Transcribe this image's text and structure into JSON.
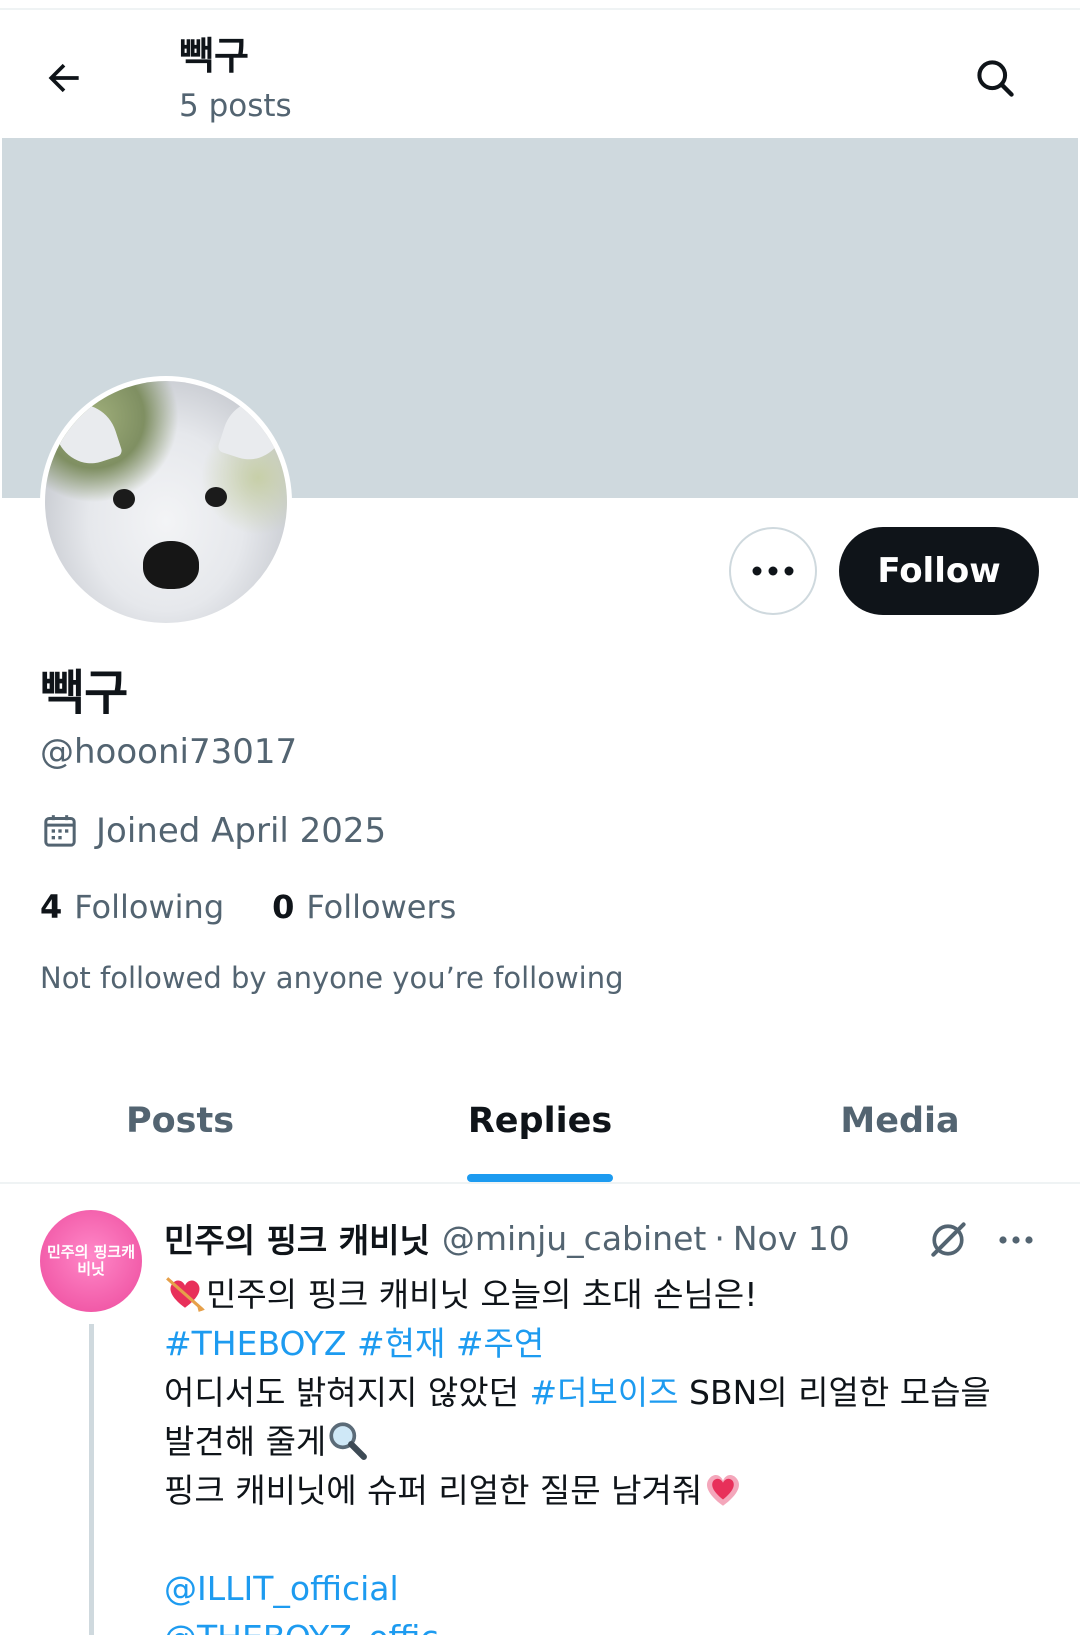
{
  "header": {
    "title": "빽구",
    "posts_count": "5 posts",
    "icons": {
      "back": "arrow-left-icon",
      "search": "search-icon"
    }
  },
  "profile": {
    "display_name": "빽구",
    "handle": "@hoooni73017",
    "joined": "Joined April 2025",
    "following_count": "4",
    "following_label": "Following",
    "followers_count": "0",
    "followers_label": "Followers",
    "not_followed_text": "Not followed by anyone you’re following",
    "follow_label": "Follow"
  },
  "tabs": [
    {
      "label": "Posts",
      "active": false
    },
    {
      "label": "Replies",
      "active": true
    },
    {
      "label": "Media",
      "active": false
    }
  ],
  "post": {
    "author_name": "민주의 핑크 캐비닛",
    "author_handle": "@minju_cabinet",
    "separator": "·",
    "date": "Nov 10",
    "avatar_text": "민주의 핑크캐비닛",
    "line1": "민주의 핑크 캐비닛 오늘의 초대 손님은!",
    "hashtag1": "#THEBOYZ",
    "hashtag2": "#현재",
    "hashtag3": "#주연",
    "line3_pre": "어디서도 밝혀지지 않았던 ",
    "line3_tag": "#더보이즈",
    "line3_post": " SBN의 리얼한 모습을",
    "line4": "발견해 줄게",
    "line5": "핑크 캐비닛에 슈퍼 리얼한 질문 남겨줘",
    "mention1": "@ILLIT_official",
    "mention2": "@THEBOYZ_offic..."
  },
  "colors": {
    "accent": "#1d9bf0",
    "text_primary": "#0f1419",
    "text_secondary": "#536471",
    "banner": "#cfd9de",
    "follow_button": "#0f1419"
  }
}
